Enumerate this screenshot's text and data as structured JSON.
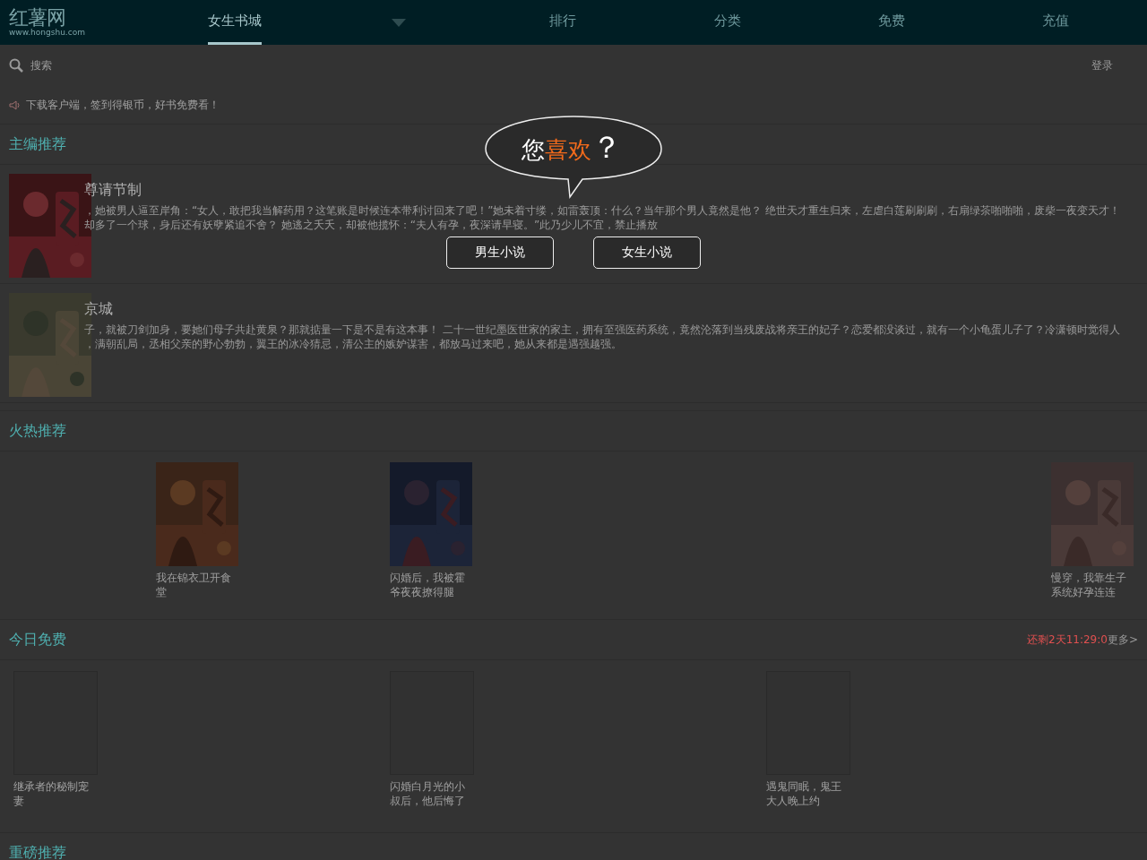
{
  "header": {
    "logo": "红薯网",
    "logo_url": "www.hongshu.com",
    "nav": [
      {
        "label": "女生书城",
        "selected": true,
        "kind": "tab"
      },
      {
        "kind": "caret"
      },
      {
        "label": "排行",
        "selected": false,
        "kind": "tab"
      },
      {
        "label": "分类",
        "selected": false,
        "kind": "tab"
      },
      {
        "label": "免费",
        "selected": false,
        "kind": "tab"
      },
      {
        "label": "充值",
        "selected": false,
        "kind": "tab"
      }
    ]
  },
  "search": {
    "placeholder": "搜索",
    "login": "登录"
  },
  "notice": "下载客户端，签到得银币，好书免费看！",
  "editor_picks": {
    "title": "主编推荐",
    "books": [
      {
        "title": "尊请节制",
        "lines": [
          "，她被男人逼至岸角：“女人，敢把我当解药用？这笔账是时候连本带利讨回来了吧！”她未着寸缕，如雷轰顶：什么？当年那个男人竟然是他？ 绝世天才重生归来，左虐白莲刷刷刷，右扇绿茶啪啪啪，废柴一夜变天才！",
          "却多了一个球，身后还有妖孽紧追不舍？ 她逃之夭夭，却被他揽怀：“夫人有孕，夜深请早寝。”此乃少儿不宜，禁止播放"
        ]
      },
      {
        "title": "京城",
        "lines": [
          "子，就被刀剑加身，要她们母子共赴黄泉？那就掂量一下是不是有这本事！ 二十一世纪墨医世家的家主，拥有至强医药系统，竟然沦落到当残废战将亲王的妃子？恋爱都没谈过，就有一个小龟蛋儿子了？冷潇顿时觉得人",
          "，满朝乱局，丞相父亲的野心勃勃，翼王的冰冷猜忌，清公主的嫉妒谋害，都放马过来吧，她从来都是遇强越强。"
        ]
      }
    ]
  },
  "hot": {
    "title": "火热推荐",
    "books": [
      {
        "title": "我在锦衣卫开食堂"
      },
      {
        "title": "闪婚后，我被霍爷夜夜撩得腿"
      },
      {
        "title": "慢穿，我靠生子系统好孕连连"
      }
    ]
  },
  "free": {
    "title": "今日免费",
    "countdown": "还剩2天11:29:0",
    "more": "更多>",
    "books": [
      {
        "title": "继承者的秘制宠妻"
      },
      {
        "title": "闪婚白月光的小叔后，他后悔了"
      },
      {
        "title": "遇鬼同眠，鬼王大人晚上约"
      }
    ]
  },
  "heavy": {
    "title": "重磅推荐"
  },
  "modal": {
    "question": [
      {
        "text": "您",
        "kind": "plain"
      },
      {
        "text": "喜欢",
        "kind": "accent"
      },
      {
        "text": "？",
        "kind": "mark"
      }
    ],
    "buttons": [
      "男生小说",
      "女生小说"
    ]
  }
}
